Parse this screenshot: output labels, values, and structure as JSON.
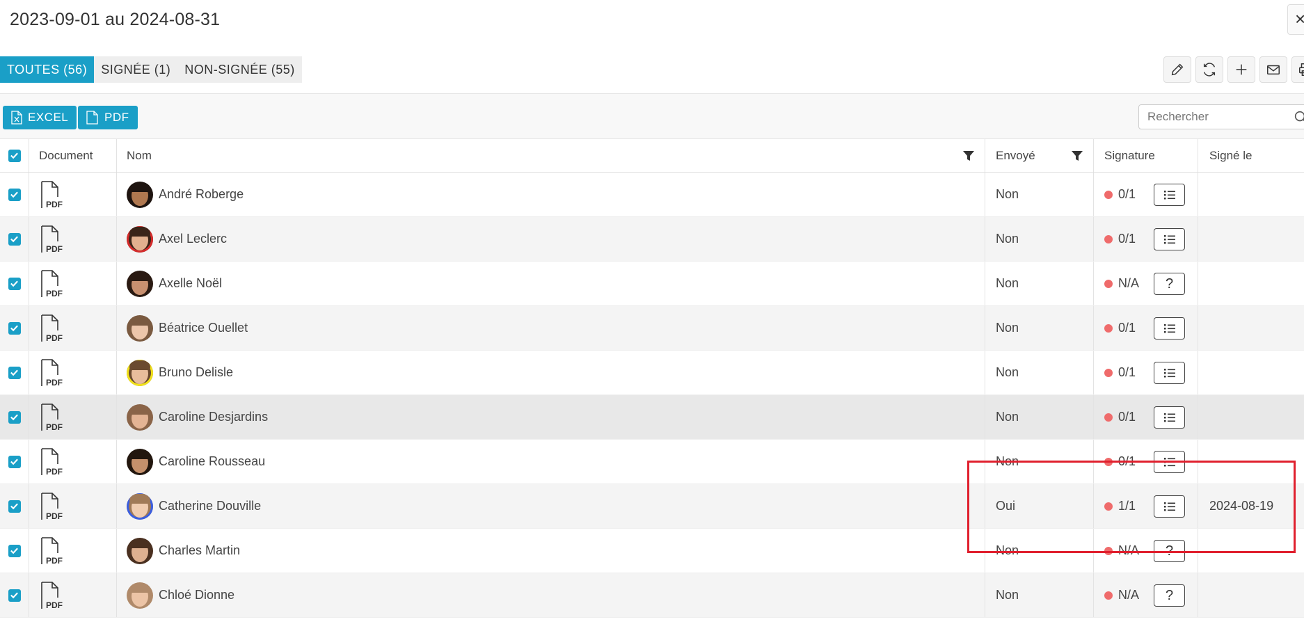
{
  "title": "2023-09-01 au 2024-08-31",
  "close_label": "×",
  "tabs": [
    {
      "label": "TOUTES (56)",
      "active": true
    },
    {
      "label": "SIGNÉE (1)",
      "active": false
    },
    {
      "label": "NON-SIGNÉE (55)",
      "active": false
    }
  ],
  "toolbar_icons": [
    "pencil-icon",
    "refresh-icon",
    "plus-icon",
    "mail-icon",
    "print-icon"
  ],
  "exports": {
    "excel_label": "EXCEL",
    "pdf_label": "PDF",
    "pdf_badge": "PDF"
  },
  "search": {
    "placeholder": "Rechercher"
  },
  "columns": {
    "document": "Document",
    "nom": "Nom",
    "envoye": "Envoyé",
    "signature": "Signature",
    "signe_le": "Signé le"
  },
  "doc_badge": "PDF",
  "rows": [
    {
      "name": "André Roberge",
      "envoye": "Non",
      "signature": "0/1",
      "action": "list",
      "signe_le": "",
      "skin": "#b07850",
      "hair": "#1e1410",
      "ring": ""
    },
    {
      "name": "Axel Leclerc",
      "envoye": "Non",
      "signature": "0/1",
      "action": "list",
      "signe_le": "",
      "skin": "#e2b08e",
      "hair": "#3a2418",
      "ring": "#d62b2b"
    },
    {
      "name": "Axelle Noël",
      "envoye": "Non",
      "signature": "N/A",
      "action": "help",
      "signe_le": "",
      "skin": "#c89070",
      "hair": "#2a1a12",
      "ring": ""
    },
    {
      "name": "Béatrice Ouellet",
      "envoye": "Non",
      "signature": "0/1",
      "action": "list",
      "signe_le": "",
      "skin": "#ecc6aa",
      "hair": "#7a5a40",
      "ring": ""
    },
    {
      "name": "Bruno Delisle",
      "envoye": "Non",
      "signature": "0/1",
      "action": "list",
      "signe_le": "",
      "skin": "#e8bd9c",
      "hair": "#6a4a30",
      "ring": "#f2e21a"
    },
    {
      "name": "Caroline Desjardins",
      "envoye": "Non",
      "signature": "0/1",
      "action": "list",
      "signe_le": "",
      "skin": "#e4b494",
      "hair": "#8a6448",
      "ring": ""
    },
    {
      "name": "Caroline Rousseau",
      "envoye": "Non",
      "signature": "0/1",
      "action": "list",
      "signe_le": "",
      "skin": "#c4906c",
      "hair": "#22160e",
      "ring": ""
    },
    {
      "name": "Catherine Douville",
      "envoye": "Oui",
      "signature": "1/1",
      "action": "list",
      "signe_le": "2024-08-19",
      "skin": "#f0ccb0",
      "hair": "#a07a58",
      "ring": "#3a5ee0"
    },
    {
      "name": "Charles Martin",
      "envoye": "Non",
      "signature": "N/A",
      "action": "help",
      "signe_le": "",
      "skin": "#deb090",
      "hair": "#4a3020",
      "ring": ""
    },
    {
      "name": "Chloé Dionne",
      "envoye": "Non",
      "signature": "N/A",
      "action": "help",
      "signe_le": "",
      "skin": "#ecc4a6",
      "hair": "#b08a6a",
      "ring": ""
    }
  ],
  "colors": {
    "accent": "#1a9fc7",
    "dot": "#ef6b6b",
    "highlight": "#e0202e"
  }
}
